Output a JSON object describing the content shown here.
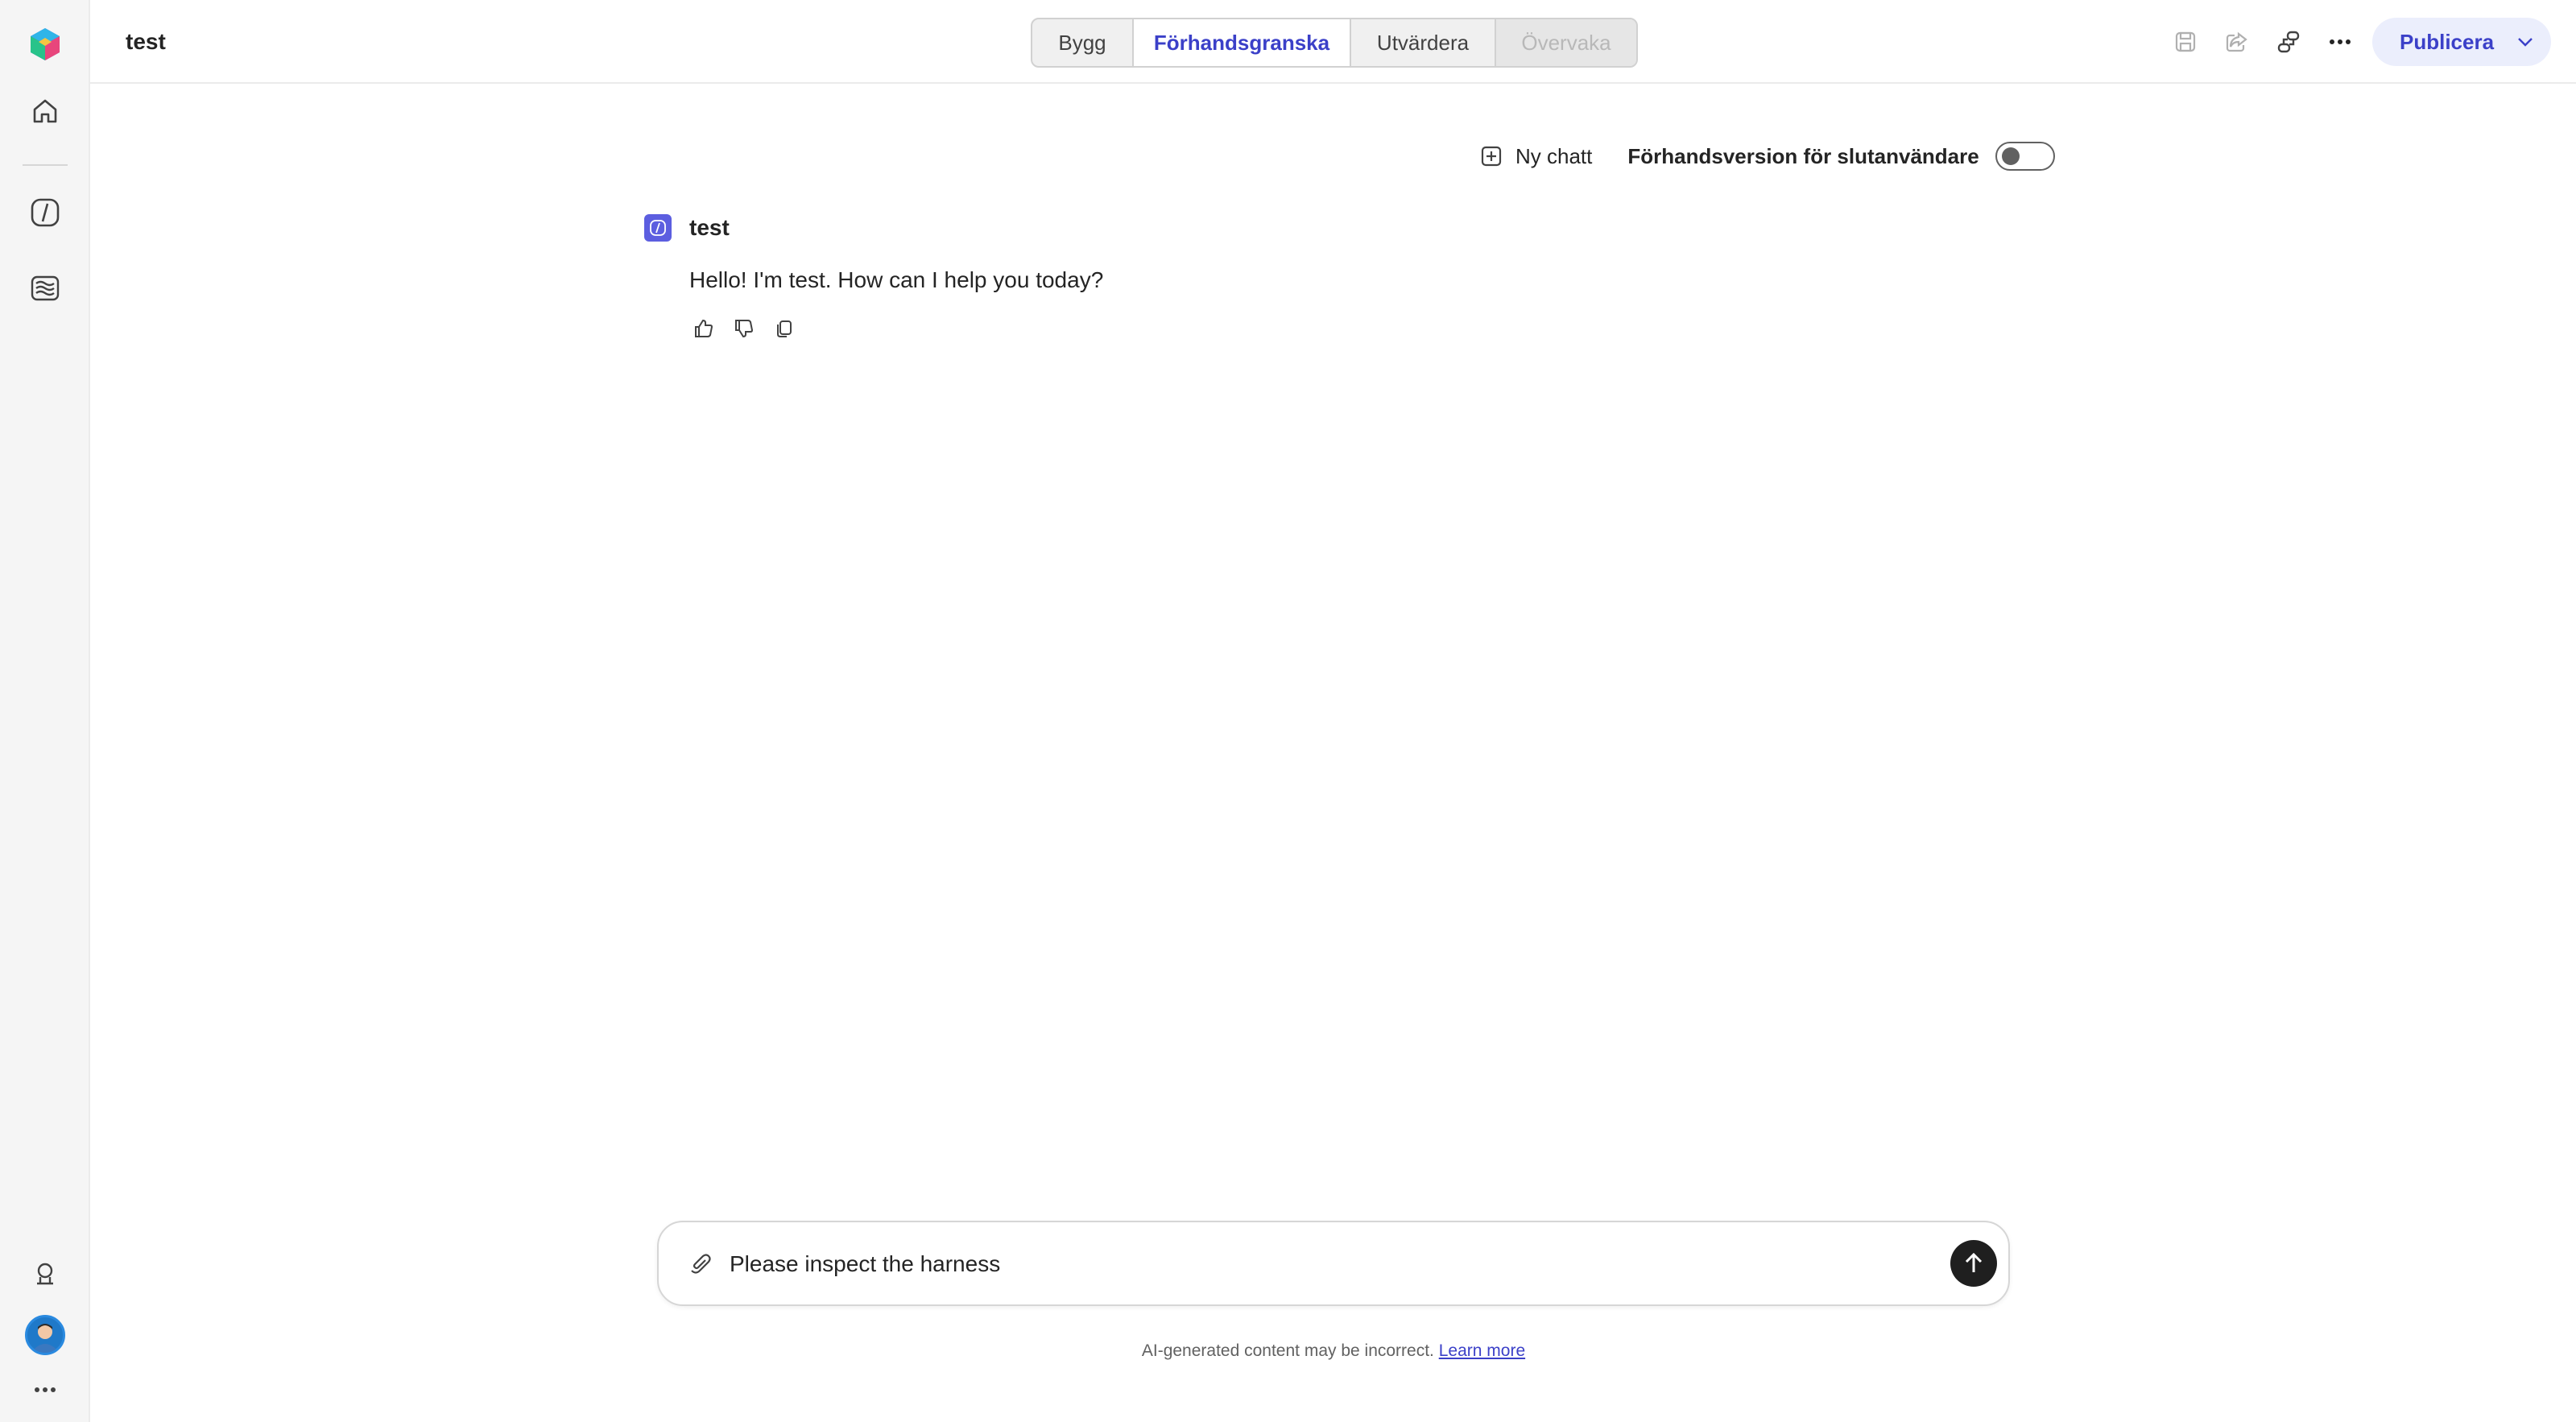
{
  "nav_rail": {
    "items": [
      {
        "icon": "app-logo-icon"
      },
      {
        "icon": "home-icon"
      },
      {
        "icon": "agents-icon"
      },
      {
        "icon": "library-icon"
      }
    ],
    "bottom": [
      {
        "icon": "feedback-icon"
      },
      {
        "icon": "user-avatar"
      },
      {
        "icon": "more-icon"
      }
    ]
  },
  "header": {
    "title": "test",
    "tabs": [
      {
        "label": "Bygg",
        "state": "normal"
      },
      {
        "label": "Förhandsgranska",
        "state": "active"
      },
      {
        "label": "Utvärdera",
        "state": "normal"
      },
      {
        "label": "Övervaka",
        "state": "disabled"
      }
    ],
    "tools": [
      "save-icon",
      "share-icon",
      "connect-icon",
      "more-icon"
    ],
    "publish_label": "Publicera"
  },
  "chat": {
    "new_chat_label": "Ny chatt",
    "preview_toggle_label": "Förhandsversion för slutanvändare",
    "preview_toggle_on": false,
    "bot_name": "test",
    "bot_message": "Hello! I'm test. How can I help you today?",
    "message_actions": [
      "thumbs-up-icon",
      "thumbs-down-icon",
      "copy-icon"
    ]
  },
  "composer": {
    "value": "Please inspect the harness"
  },
  "footer": {
    "disclaimer": "AI-generated content may be incorrect.",
    "learn_more": "Learn more"
  },
  "colors": {
    "accent": "#3b40c8",
    "publish_bg": "#ebeefc",
    "bot_avatar": "#5c5ee0"
  }
}
